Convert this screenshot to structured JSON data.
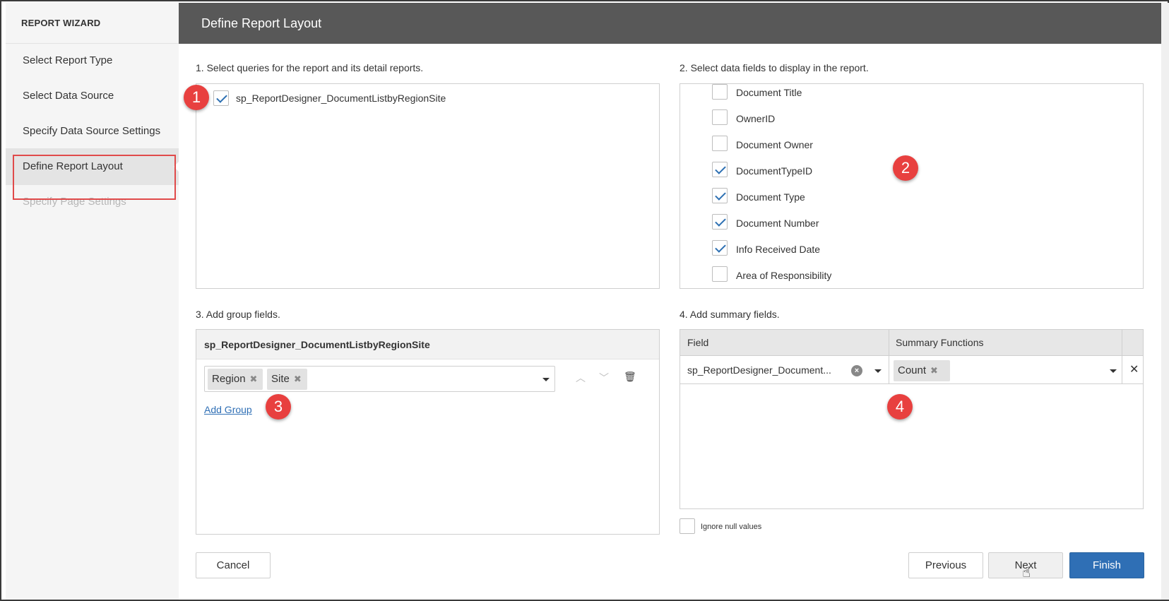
{
  "wizard": {
    "title": "REPORT WIZARD"
  },
  "sidebar": {
    "items": [
      {
        "label": "Select Report Type",
        "state": "normal"
      },
      {
        "label": "Select Data Source",
        "state": "normal"
      },
      {
        "label": "Specify Data Source Settings",
        "state": "normal"
      },
      {
        "label": "Define Report Layout",
        "state": "active"
      },
      {
        "label": "Specify Page Settings",
        "state": "disabled"
      }
    ]
  },
  "header": {
    "title": "Define Report Layout"
  },
  "steps": {
    "s1": {
      "label": "1. Select queries for the report and its detail reports.",
      "queries": [
        {
          "name": "sp_ReportDesigner_DocumentListbyRegionSite",
          "checked": true
        }
      ]
    },
    "s2": {
      "label": "2. Select data fields to display in the report.",
      "fields": [
        {
          "name": "Document Title",
          "checked": false
        },
        {
          "name": "OwnerID",
          "checked": false
        },
        {
          "name": "Document Owner",
          "checked": false
        },
        {
          "name": "DocumentTypeID",
          "checked": true
        },
        {
          "name": "Document Type",
          "checked": true
        },
        {
          "name": "Document Number",
          "checked": true
        },
        {
          "name": "Info Received Date",
          "checked": true
        },
        {
          "name": "Area of Responsibility",
          "checked": false
        }
      ]
    },
    "s3": {
      "label": "3. Add group fields.",
      "query_name": "sp_ReportDesigner_DocumentListbyRegionSite",
      "groups": [
        "Region",
        "Site"
      ],
      "add_group": "Add Group"
    },
    "s4": {
      "label": "4. Add summary fields.",
      "col_field": "Field",
      "col_functions": "Summary Functions",
      "row_field": "sp_ReportDesigner_Document...",
      "row_function": "Count",
      "ignore_null": "Ignore null values"
    }
  },
  "badges": [
    "1",
    "2",
    "3",
    "4"
  ],
  "buttons": {
    "cancel": "Cancel",
    "previous": "Previous",
    "next": "Next",
    "finish": "Finish"
  },
  "colors": {
    "header_bg": "#585858",
    "accent": "#2f6fb5",
    "badge": "#e8403f",
    "highlight_box": "#e04a4a"
  }
}
